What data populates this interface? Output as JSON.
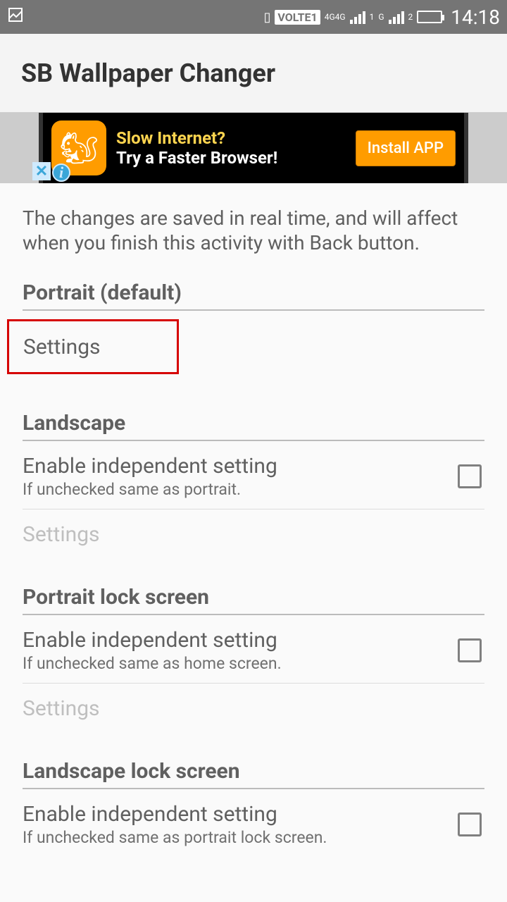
{
  "status": {
    "volte": "VOLTE1",
    "net_label": "4G4G",
    "sim1_sub": "1",
    "sim2_label": "G",
    "sim2_sub": "2",
    "time": "14:18"
  },
  "app": {
    "title": "SB Wallpaper Changer"
  },
  "ad": {
    "line1": "Slow Internet?",
    "line2": "Try a Faster Browser!",
    "button": "Install APP",
    "close": "✕",
    "info": "i"
  },
  "intro": "The changes are saved in real time, and will affect when you finish this activity with Back button.",
  "sections": {
    "portrait": {
      "header": "Portrait (default)",
      "settings": "Settings"
    },
    "landscape": {
      "header": "Landscape",
      "enable_title": "Enable independent setting",
      "enable_sub": "If unchecked same as portrait.",
      "settings": "Settings"
    },
    "portrait_lock": {
      "header": "Portrait lock screen",
      "enable_title": "Enable independent setting",
      "enable_sub": "If unchecked same as home screen.",
      "settings": "Settings"
    },
    "landscape_lock": {
      "header": "Landscape lock screen",
      "enable_title": "Enable independent setting",
      "enable_sub": "If unchecked same as portrait lock screen."
    }
  }
}
